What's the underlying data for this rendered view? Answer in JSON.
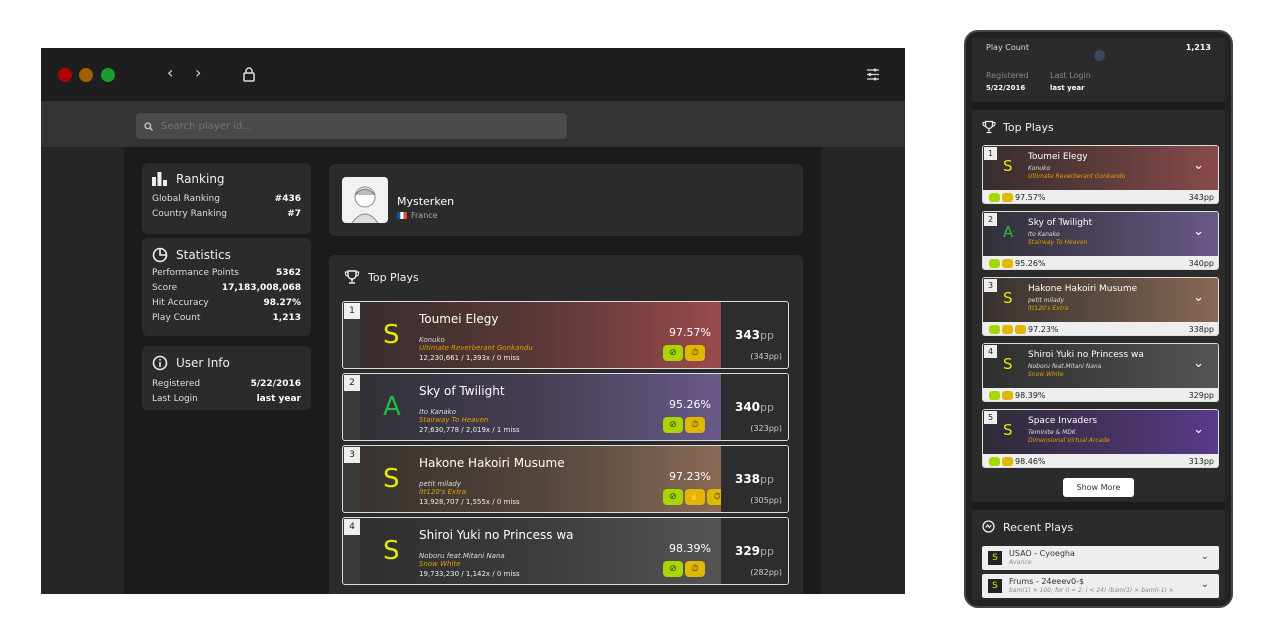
{
  "colors": {
    "accent_yellow": "#e8e800",
    "mod_yellow": "#e0b800",
    "mod_green": "#a9d600",
    "difficulty_orange": "#e0a000"
  },
  "search": {
    "placeholder": "Search player id..."
  },
  "ranking": {
    "title": "Ranking",
    "global_label": "Global Ranking",
    "global_value": "#436",
    "country_label": "Country Ranking",
    "country_value": "#7"
  },
  "statistics": {
    "title": "Statistics",
    "rows": [
      {
        "label": "Performance Points",
        "value": "5362"
      },
      {
        "label": "Score",
        "value": "17,183,008,068"
      },
      {
        "label": "Hit Accuracy",
        "value": "98.27%"
      },
      {
        "label": "Play Count",
        "value": "1,213"
      }
    ]
  },
  "user_info": {
    "title": "User Info",
    "registered_label": "Registered",
    "registered_value": "5/22/2016",
    "last_login_label": "Last Login",
    "last_login_value": "last year"
  },
  "profile": {
    "name": "Mysterken",
    "country": "France"
  },
  "top_plays": {
    "title": "Top Plays",
    "unit": "pp",
    "items": [
      {
        "rank": "1",
        "grade": "S",
        "title": "Toumei Elegy",
        "artist": "Konuko",
        "difficulty": "Ultimate Reverberant Gonkandu",
        "score": "12,230,661 / 1,393x / 0 miss",
        "accuracy": "97.57%",
        "pp": "343",
        "weighted": "(343pp)",
        "bg": "#9a4b4b"
      },
      {
        "rank": "2",
        "grade": "A",
        "title": "Sky of Twilight",
        "artist": "Ito Kanako",
        "difficulty": "Stairway To Heaven",
        "score": "27,630,778 / 2,019x / 1 miss",
        "accuracy": "95.26%",
        "pp": "340",
        "weighted": "(323pp)",
        "bg": "#6a5a8a"
      },
      {
        "rank": "3",
        "grade": "S",
        "title": "Hakone Hakoiri Musume",
        "artist": "petit milady",
        "difficulty": "ltt120's Extra",
        "score": "13,928,707 / 1,555x / 0 miss",
        "accuracy": "97.23%",
        "pp": "338",
        "weighted": "(305pp)",
        "bg": "#8a6a55"
      },
      {
        "rank": "4",
        "grade": "S",
        "title": "Shiroi Yuki no Princess wa",
        "artist": "Noboru feat.Mitani Nana",
        "difficulty": "Snow White",
        "score": "19,733,230 / 1,142x / 0 miss",
        "accuracy": "98.39%",
        "pp": "329",
        "weighted": "(282pp)",
        "bg": "#555555"
      }
    ]
  },
  "mobile": {
    "play_count_label": "Play Count",
    "play_count_value": "1,213",
    "registered_label": "Registered",
    "registered_value": "5/22/2016",
    "last_login_label": "Last Login",
    "last_login_value": "last year",
    "top_plays_title": "Top Plays",
    "plays": [
      {
        "rank": "1",
        "grade": "S",
        "title": "Toumei Elegy",
        "artist": "Konuko",
        "difficulty": "Ultimate Reverberant Gonkandu",
        "accuracy": "97.57%",
        "pp": "343pp",
        "bg": "#8a4b4b"
      },
      {
        "rank": "2",
        "grade": "A",
        "title": "Sky of Twilight",
        "artist": "Ito Kanako",
        "difficulty": "Stairway To Heaven",
        "accuracy": "95.26%",
        "pp": "340pp",
        "bg": "#6a5a8a"
      },
      {
        "rank": "3",
        "grade": "S",
        "title": "Hakone Hakoiri Musume",
        "artist": "petit milady",
        "difficulty": "ltt120's Extra",
        "accuracy": "97.23%",
        "pp": "338pp",
        "bg": "#8a6a55"
      },
      {
        "rank": "4",
        "grade": "S",
        "title": "Shiroi Yuki no Princess wa",
        "artist": "Noboru feat.Mitani Nana",
        "difficulty": "Snow White",
        "accuracy": "98.39%",
        "pp": "329pp",
        "bg": "#555555"
      },
      {
        "rank": "5",
        "grade": "S",
        "title": "Space Invaders",
        "artist": "Teminite & MDK",
        "difficulty": "Dimensional Virtual Arcade",
        "accuracy": "98.46%",
        "pp": "313pp",
        "bg": "#5a3a8a"
      }
    ],
    "show_more": "Show More",
    "recent_title": "Recent Plays",
    "recent": [
      {
        "grade": "S",
        "name": "USAO - Cyoegha",
        "sub": "Avarice"
      },
      {
        "grade": "S",
        "name": "Frums - 24eeev0-$",
        "sub": "bam(1) × 100; for (i = 2; i < 24) (bam(1) × bam(i-1) ×"
      }
    ]
  }
}
